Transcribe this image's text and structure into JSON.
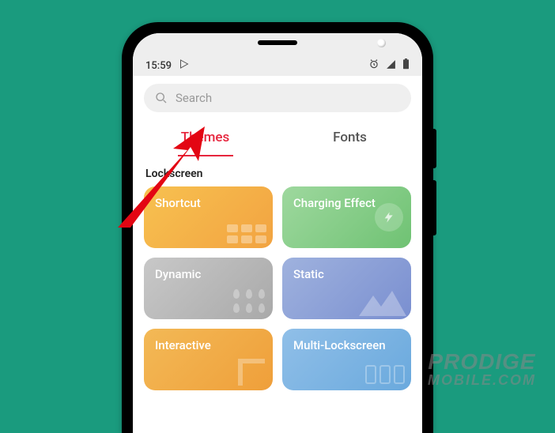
{
  "status": {
    "time": "15:59",
    "play_icon": "play-store",
    "alarm_icon": "alarm",
    "signal_icon": "signal",
    "battery_icon": "battery"
  },
  "search": {
    "placeholder": "Search"
  },
  "tabs": {
    "themes": "Themes",
    "fonts": "Fonts"
  },
  "section": {
    "title": "Lockscreen"
  },
  "cards": {
    "shortcut": "Shortcut",
    "charging": "Charging Effect",
    "dynamic": "Dynamic",
    "static": "Static",
    "interactive": "Interactive",
    "multi": "Multi-Lockscreen"
  },
  "watermark": {
    "line1": "PRODIGE",
    "line2": "MOBILE.COM"
  }
}
